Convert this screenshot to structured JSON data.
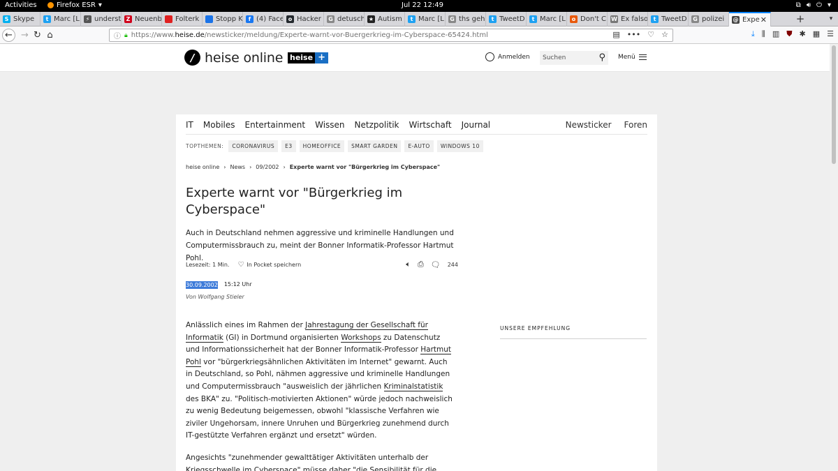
{
  "system": {
    "activities": "Activities",
    "app_name": "Firefox ESR",
    "clock": "Jul 22  12:49"
  },
  "tabs": [
    {
      "label": "Skype",
      "color": "#00aff0",
      "glyph": "S"
    },
    {
      "label": "Marc [L",
      "color": "#1da1f2",
      "glyph": "t"
    },
    {
      "label": "underst",
      "color": "#555555",
      "glyph": "⚡"
    },
    {
      "label": "Neuenb",
      "color": "#d0021b",
      "glyph": "Z"
    },
    {
      "label": "Folterk",
      "color": "#e02020",
      "glyph": ""
    },
    {
      "label": "Stopp K",
      "color": "#1a73e8",
      "glyph": ""
    },
    {
      "label": "(4) Face",
      "color": "#1877f2",
      "glyph": "f"
    },
    {
      "label": "Hacker",
      "color": "#24292e",
      "glyph": "o"
    },
    {
      "label": "detusch",
      "color": "#888888",
      "glyph": "G"
    },
    {
      "label": "Autism",
      "color": "#222222",
      "glyph": "★"
    },
    {
      "label": "Marc [L",
      "color": "#1da1f2",
      "glyph": "t"
    },
    {
      "label": "ths geh",
      "color": "#888888",
      "glyph": "G"
    },
    {
      "label": "TweetD",
      "color": "#1da1f2",
      "glyph": "t"
    },
    {
      "label": "Marc [L",
      "color": "#1da1f2",
      "glyph": "t"
    },
    {
      "label": "Don't C",
      "color": "#e8590c",
      "glyph": "o"
    },
    {
      "label": "Ex falso",
      "color": "#777777",
      "glyph": "W"
    },
    {
      "label": "TweetD",
      "color": "#1da1f2",
      "glyph": "t"
    },
    {
      "label": "polizei",
      "color": "#888888",
      "glyph": "G"
    },
    {
      "label": "Expe",
      "color": "#444444",
      "glyph": "@"
    }
  ],
  "urlbar": {
    "prefix": "https://www.",
    "host": "heise.de",
    "path": "/newsticker/meldung/Experte-warnt-vor-Buergerkrieg-im-Cyberspace-65424.html"
  },
  "header": {
    "logo_text": "heise online",
    "plus_text": "heise",
    "login_label": "Anmelden",
    "search_placeholder": "Suchen",
    "menu_label": "Menü"
  },
  "nav": {
    "items": [
      "IT",
      "Mobiles",
      "Entertainment",
      "Wissen",
      "Netzpolitik",
      "Wirtschaft",
      "Journal"
    ],
    "right": [
      "Newsticker",
      "Foren"
    ]
  },
  "topics": {
    "label": "TOPTHEMEN:",
    "items": [
      "CORONAVIRUS",
      "E3",
      "HOMEOFFICE",
      "SMART GARDEN",
      "E-AUTO",
      "WINDOWS 10"
    ]
  },
  "breadcrumb": [
    "heise online",
    "News",
    "09/2002",
    "Experte warnt vor \"Bürgerkrieg im Cyberspace\""
  ],
  "article": {
    "title": "Experte warnt vor \"Bürgerkrieg im Cyberspace\"",
    "lead": "Auch in Deutschland nehmen aggressive und kriminelle Handlungen und Computermissbrauch zu, meint der Bonner Informatik-Professor Hartmut Pohl.",
    "reading_label": "Lesezeit:",
    "reading_value": "1 Min.",
    "pocket_label": "In Pocket speichern",
    "comment_count": "244",
    "date": "30.09.2002",
    "time": "15:12 Uhr",
    "author": "Von Wolfgang Stieler",
    "p1": {
      "t1": "Anlässlich eines im Rahmen der ",
      "l1": "Jahrestagung der Gesellschaft für Informatik",
      "t2": " (GI) in Dortmund organisierten ",
      "l2": "Workshops",
      "t3": " zu Datenschutz und Informationssicherheit hat der Bonner Informatik-Professor ",
      "l3": "Hartmut Pohl",
      "t4": " vor \"bürgerkriegsähnlichen Aktivitäten im Internet\" gewarnt. Auch in Deutschland, so Pohl, nähmen aggressive und kriminelle Handlungen und Computermissbrauch \"ausweislich der jährlichen ",
      "l4": "Kriminalstatistik",
      "t5": " des BKA\" zu. \"Politisch-motivierten Aktionen\" würde jedoch nachweislich zu wenig Bedeutung beigemessen, obwohl \"klassische Verfahren wie ziviler Ungehorsam, innere Unruhen und Bürgerkrieg zunehmend durch IT-gestützte Verfahren ergänzt und ersetzt\" würden."
    },
    "p2": "Angesichts \"zunehmender gewalttätiger Aktivitäten unterhalb der Kriegsschwelle im Cyberspace\" müsse daher \"die Sensibilität für die"
  },
  "recommendation": "UNSERE EMPFEHLUNG"
}
